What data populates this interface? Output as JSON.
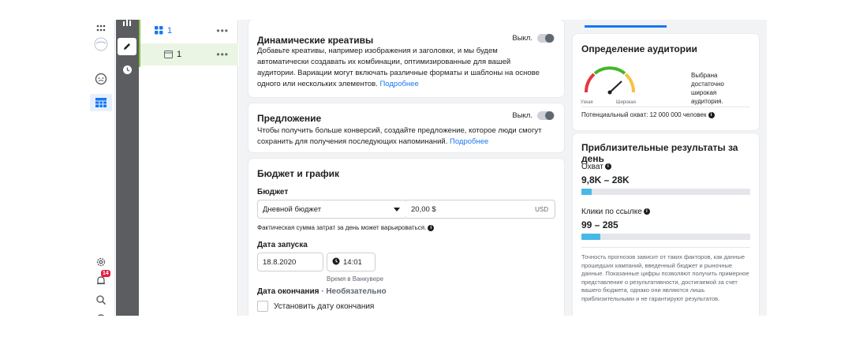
{
  "left_nav": {
    "notifications_count": "14"
  },
  "tree": {
    "campaign_label": "1",
    "adset_label": "1",
    "more": "•••"
  },
  "dynamic": {
    "title": "Динамические креативы",
    "toggle_label": "Выкл.",
    "text": "Добавьте креативы, например изображения и заголовки, и мы будем автоматически создавать их комбинации, оптимизированные для вашей аудитории. Вариации могут включать различные форматы и шаблоны на основе одного или нескольких элементов.",
    "link": "Подробнее"
  },
  "offer": {
    "title": "Предложение",
    "toggle_label": "Выкл.",
    "text": "Чтобы получить больше конверсий, создайте предложение, которое люди смогут сохранить для получения последующих напоминаний.",
    "link": "Подробнее"
  },
  "budget": {
    "section_title": "Бюджет и график",
    "budget_label": "Бюджет",
    "budget_type": "Дневной бюджет",
    "amount": "20,00 $",
    "currency": "USD",
    "note": "Фактическая сумма затрат за день может варьироваться.",
    "start_label": "Дата запуска",
    "start_date": "18.8.2020",
    "start_time": "14:01",
    "timezone": "Время в Ванкувере",
    "end_label": "Дата окончания",
    "end_optional": " · Необязательно",
    "end_checkbox": "Установить дату окончания"
  },
  "audience": {
    "title": "Определение аудитории",
    "gauge_narrow": "Узкая",
    "gauge_wide": "Широкая",
    "status": "Выбрана достаточно широкая аудитория.",
    "potential_reach": "Потенциальный охват: 12 000 000 человек"
  },
  "results": {
    "title": "Приблизительные результаты за день",
    "reach_label": "Охват",
    "reach_value": "9,8K – 28K",
    "reach_fill": 0.06,
    "clicks_label": "Клики по ссылке",
    "clicks_value": "99 – 285",
    "clicks_fill": 0.11,
    "disclaimer": "Точность прогнозов зависит от таких факторов, как данные прошедших кампаний, введенный бюджет и рыночные данные. Показанные цифры позволяют получить примерное представление о результативности, достигаемой за счет вашего бюджета, однако они являются лишь приблизительными и не гарантируют результатов."
  },
  "colors": {
    "accent": "#1877f2",
    "bar": "#48b8e7",
    "rail": "#5b5d61",
    "selected_row": "#eaf5e3",
    "badge": "#e41e3f"
  }
}
